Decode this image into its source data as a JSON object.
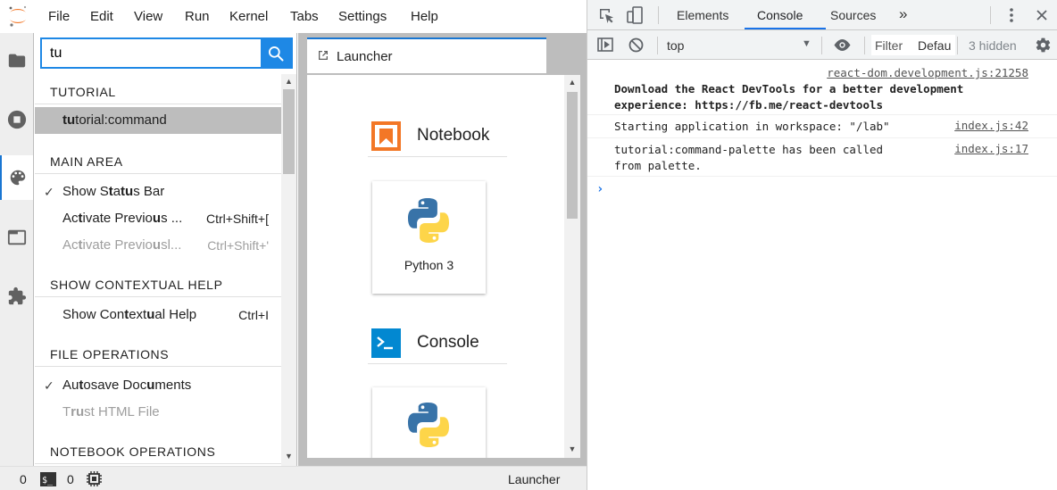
{
  "menubar": {
    "items": [
      "File",
      "Edit",
      "View",
      "Run",
      "Kernel",
      "Tabs",
      "Settings",
      "Help"
    ]
  },
  "palette": {
    "search_value": "tu",
    "categories": [
      {
        "title": "TUTORIAL",
        "commands": [
          {
            "label_parts": [
              {
                "t": "tu",
                "b": true
              },
              {
                "t": "torial:command",
                "b": false
              }
            ],
            "shortcut": "",
            "checked": false,
            "disabled": false,
            "selected": true
          }
        ]
      },
      {
        "title": "MAIN AREA",
        "commands": [
          {
            "label_parts": [
              {
                "t": "Show S",
                "b": false
              },
              {
                "t": "t",
                "b": true
              },
              {
                "t": "a",
                "b": false
              },
              {
                "t": "tu",
                "b": true
              },
              {
                "t": "s Bar",
                "b": false
              }
            ],
            "shortcut": "",
            "checked": true,
            "disabled": false,
            "selected": false
          },
          {
            "label_parts": [
              {
                "t": "Ac",
                "b": false
              },
              {
                "t": "t",
                "b": true
              },
              {
                "t": "ivate Previo",
                "b": false
              },
              {
                "t": "u",
                "b": true
              },
              {
                "t": "s ...",
                "b": false
              }
            ],
            "shortcut": "Ctrl+Shift+[",
            "checked": false,
            "disabled": false,
            "selected": false
          },
          {
            "label_parts": [
              {
                "t": "Ac",
                "b": false
              },
              {
                "t": "t",
                "b": true
              },
              {
                "t": "ivate Previo",
                "b": false
              },
              {
                "t": "u",
                "b": true
              },
              {
                "t": "sl...",
                "b": false
              }
            ],
            "shortcut": "Ctrl+Shift+'",
            "checked": false,
            "disabled": true,
            "selected": false
          }
        ]
      },
      {
        "title": "SHOW CONTEXTUAL HELP",
        "commands": [
          {
            "label_parts": [
              {
                "t": "Show Con",
                "b": false
              },
              {
                "t": "t",
                "b": true
              },
              {
                "t": "ext",
                "b": false
              },
              {
                "t": "u",
                "b": true
              },
              {
                "t": "al Help",
                "b": false
              }
            ],
            "shortcut": "Ctrl+I",
            "checked": false,
            "disabled": false,
            "selected": false
          }
        ]
      },
      {
        "title": "FILE OPERATIONS",
        "commands": [
          {
            "label_parts": [
              {
                "t": "Au",
                "b": false
              },
              {
                "t": "t",
                "b": true
              },
              {
                "t": "osave Doc",
                "b": false
              },
              {
                "t": "u",
                "b": true
              },
              {
                "t": "ments",
                "b": false
              }
            ],
            "shortcut": "",
            "checked": true,
            "disabled": false,
            "selected": false
          },
          {
            "label_parts": [
              {
                "t": "T",
                "b": false
              },
              {
                "t": "ru",
                "b": true
              },
              {
                "t": "st HTML File",
                "b": false
              }
            ],
            "shortcut": "",
            "checked": false,
            "disabled": true,
            "selected": false
          }
        ]
      },
      {
        "title": "NOTEBOOK OPERATIONS",
        "commands": []
      }
    ]
  },
  "main": {
    "tab_label": "Launcher",
    "notebook_section": "Notebook",
    "console_section": "Console",
    "kernel_card_label": "Python 3"
  },
  "statusbar": {
    "terminals_count": "0",
    "kernels_count": "0",
    "current_activity": "Launcher"
  },
  "devtools": {
    "tabs": [
      "Elements",
      "Console",
      "Sources"
    ],
    "active_tab": "Console",
    "more_tabs": "»",
    "context": "top",
    "filter_placeholder": "Filter",
    "levels": "Defau",
    "hidden_count": "3 hidden",
    "messages": [
      {
        "source": "react-dom.development.js:21258",
        "lines": [
          "Download the React DevTools for a better development",
          "experience: https://fb.me/react-devtools"
        ],
        "bold": true
      },
      {
        "source": "index.js:42",
        "lines": [
          "Starting application in workspace: \"/lab\""
        ],
        "bold": false
      },
      {
        "source": "index.js:17",
        "lines": [
          "tutorial:command-palette has been called",
          "from palette."
        ],
        "bold": false
      }
    ],
    "prompt": "›"
  },
  "colors": {
    "accent": "#1976d2",
    "search_button": "#1e88e5",
    "selected_row": "#bdbdbd",
    "jupyter_orange": "#f37726",
    "console_blue": "#0288d1",
    "devtools_blue": "#1a73e8"
  }
}
